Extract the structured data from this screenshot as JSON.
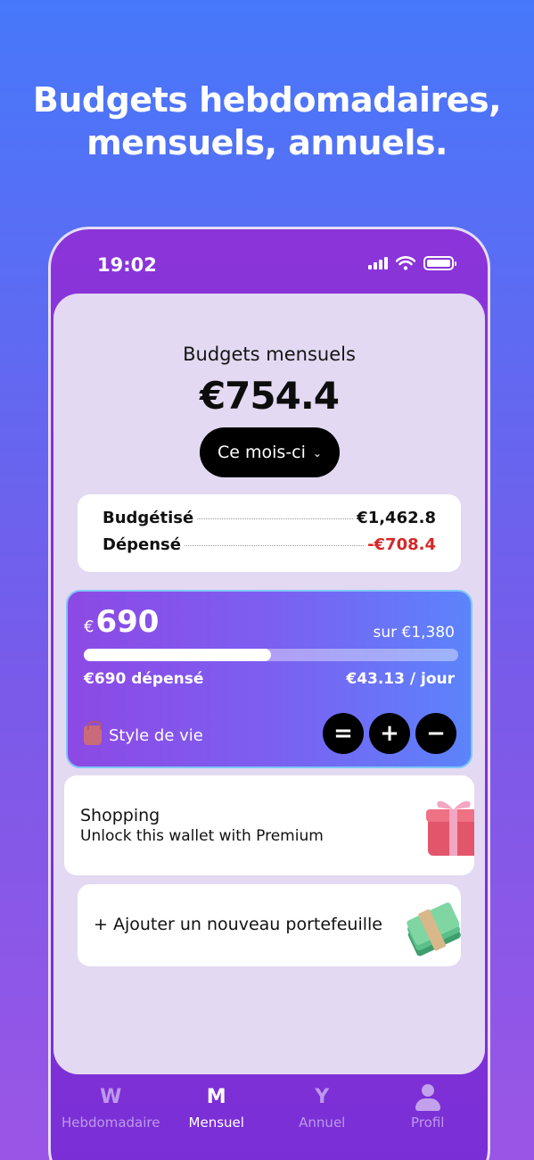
{
  "headline": {
    "line1": "Budgets hebdomadaires,",
    "line2": "mensuels, annuels."
  },
  "status_bar": {
    "time": "19:02",
    "icons": [
      "signal-icon",
      "wifi-icon",
      "battery-icon"
    ]
  },
  "header": {
    "title": "Budgets mensuels",
    "total": "€754.4",
    "period_label": "Ce mois-ci"
  },
  "summary": {
    "budgeted_label": "Budgétisé",
    "budgeted_value": "€1,462.8",
    "spent_label": "Dépensé",
    "spent_value": "-€708.4",
    "spent_color": "#d62828"
  },
  "wallet": {
    "currency": "€",
    "amount": "690",
    "limit": "sur €1,380",
    "progress_fraction": 0.5,
    "spent": "€690 dépensé",
    "per_day": "€43.13 / jour",
    "category": "Style de vie",
    "category_icon": "bag-icon",
    "buttons": [
      "equals-button",
      "plus-button",
      "minus-button"
    ]
  },
  "locked_wallet": {
    "title": "Shopping",
    "subtitle": "Unlock this wallet with Premium",
    "icon": "gift-icon"
  },
  "add_wallet": {
    "label": "+ Ajouter un nouveau portefeuille",
    "icon": "cash-icon"
  },
  "tabs": [
    {
      "icon": "W",
      "label": "Hebdomadaire",
      "active": false
    },
    {
      "icon": "M",
      "label": "Mensuel",
      "active": true
    },
    {
      "icon": "Y",
      "label": "Annuel",
      "active": false
    },
    {
      "icon": "profile-icon",
      "label": "Profil",
      "active": false
    }
  ]
}
